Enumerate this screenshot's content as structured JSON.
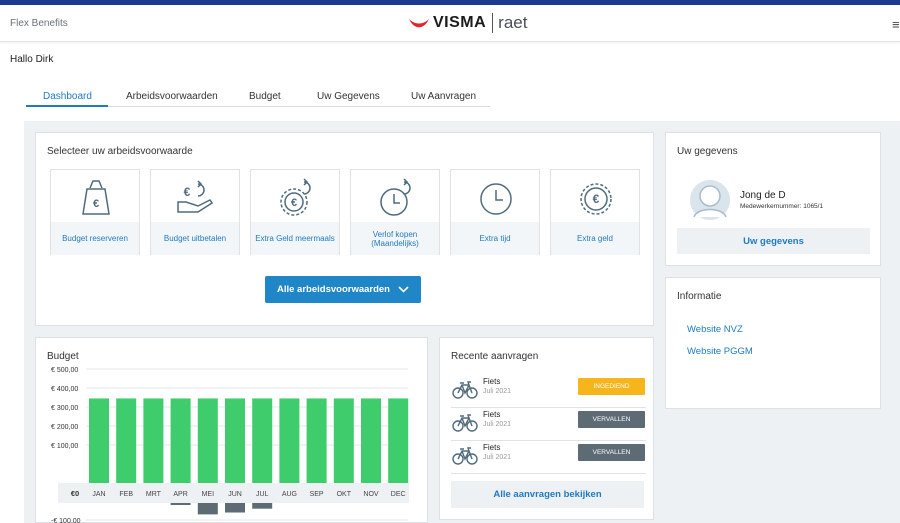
{
  "header": {
    "app_name": "Flex Benefits",
    "logo_brand": "VISMA",
    "logo_sub": "raet",
    "menu_icon": "hamburger-icon"
  },
  "greeting": "Hallo Dirk",
  "tabs": [
    {
      "label": "Dashboard",
      "active": true
    },
    {
      "label": "Arbeidsvoorwaarden",
      "active": false
    },
    {
      "label": "Budget",
      "active": false
    },
    {
      "label": "Uw Gegevens",
      "active": false
    },
    {
      "label": "Uw Aanvragen",
      "active": false
    }
  ],
  "arbeidsvoorwaarden": {
    "title": "Selecteer uw arbeidsvoorwaarde",
    "tiles": [
      {
        "label": "Budget reserveren",
        "icon": "euro-bag-icon"
      },
      {
        "label": "Budget uitbetalen",
        "icon": "euro-hand-icon"
      },
      {
        "label": "Extra Geld meermaals",
        "icon": "euro-repeat-icon"
      },
      {
        "label": "Verlof kopen (Maandelijks)",
        "icon": "clock-repeat-icon"
      },
      {
        "label": "Extra tijd",
        "icon": "clock-icon"
      },
      {
        "label": "Extra geld",
        "icon": "euro-coin-icon"
      }
    ],
    "all_button": "Alle arbeidsvoorwaarden"
  },
  "profile": {
    "title": "Uw gegevens",
    "name": "Jong de D",
    "employee_number": "Medewerkernummer: 1065/1",
    "button": "Uw gegevens"
  },
  "informatie": {
    "title": "Informatie",
    "links": [
      "Website NVZ",
      "Website PGGM"
    ]
  },
  "aanvragen": {
    "title": "Recente aanvragen",
    "items": [
      {
        "title": "Fiets",
        "date": "Juli 2021",
        "status": "INGEDIEND",
        "status_color": "#f5b51b"
      },
      {
        "title": "Fiets",
        "date": "Juli 2021",
        "status": "VERVALLEN",
        "status_color": "#5d6b75"
      },
      {
        "title": "Fiets",
        "date": "Juli 2021",
        "status": "VERVALLEN",
        "status_color": "#5d6b75"
      }
    ],
    "all_button": "Alle aanvragen bekijken"
  },
  "budget": {
    "title": "Budget",
    "zero_label": "€0"
  },
  "colors": {
    "accent": "#1f87c8",
    "link": "#1f7bc1",
    "bar_positive": "#3ecc6d",
    "bar_negative": "#5d6b75"
  },
  "chart_data": {
    "type": "bar",
    "categories": [
      "JAN",
      "FEB",
      "MRT",
      "APR",
      "MEI",
      "JUN",
      "JUL",
      "AUG",
      "SEP",
      "OKT",
      "NOV",
      "DEC"
    ],
    "series": [
      {
        "values": [
          345,
          345,
          345,
          345,
          345,
          345,
          345,
          345,
          345,
          345,
          345,
          345
        ]
      },
      {
        "values": [
          0,
          0,
          0,
          -5,
          -60,
          -50,
          -30,
          0,
          0,
          0,
          0,
          0
        ]
      }
    ],
    "ytick_labels": [
      "€ 500,00",
      "€ 400,00",
      "€ 300,00",
      "€ 200,00",
      "€ 100,00",
      "-€ 100,00"
    ],
    "yticks": [
      500,
      400,
      300,
      200,
      100,
      -100
    ],
    "ylim": [
      -100,
      500
    ],
    "grid": true
  }
}
